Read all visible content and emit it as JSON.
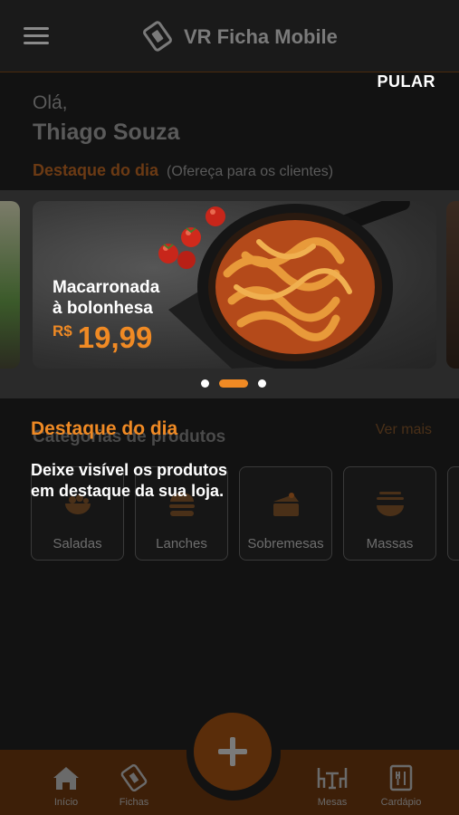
{
  "header": {
    "title": "VR Ficha Mobile",
    "menu_icon": "hamburger-icon",
    "logo_icon": "ticket-logo-icon"
  },
  "skip_label": "PULAR",
  "greeting": "Olá,",
  "user_name": "Thiago Souza",
  "featured": {
    "title": "Destaque do dia",
    "subtitle": "(Ofereça para os clientes)"
  },
  "carousel": {
    "slide": {
      "dish_line1": "Macarronada",
      "dish_line2": "à bolonhesa",
      "currency": "R$",
      "price": "19,99"
    },
    "active_index": 1,
    "count": 3
  },
  "categories": {
    "heading": "Categorias de produtos",
    "see_more": "Ver mais",
    "items": [
      {
        "label": "Saladas",
        "icon": "salad-icon"
      },
      {
        "label": "Lanches",
        "icon": "burger-icon"
      },
      {
        "label": "Sobremesas",
        "icon": "cake-icon"
      },
      {
        "label": "Massas",
        "icon": "pasta-icon"
      }
    ]
  },
  "tooltip": {
    "title": "Destaque do dia",
    "text": "Deixe visível os produtos em destaque da sua loja."
  },
  "bottom_nav": {
    "items": [
      {
        "label": "Início",
        "icon": "home-icon"
      },
      {
        "label": "Fichas",
        "icon": "ticket-icon"
      },
      {
        "label": "Mesas",
        "icon": "tables-icon"
      },
      {
        "label": "Cardápio",
        "icon": "menu-book-icon"
      }
    ],
    "fab_icon": "plus-icon"
  },
  "colors": {
    "accent": "#f08a24",
    "background": "#121212",
    "nav": "#3d1f08"
  }
}
